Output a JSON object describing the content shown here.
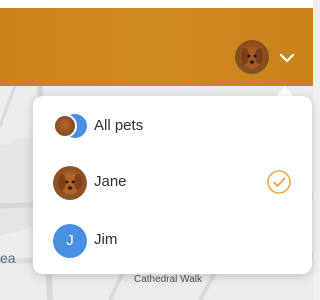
{
  "header": {
    "avatar_icon": "dog-photo-avatar",
    "chevron_icon": "chevron-down-icon",
    "accent_color": "#c98318"
  },
  "map": {
    "label_ea": "ea",
    "label_street": "Cathedral Walk",
    "label_road": "e"
  },
  "pet_menu": {
    "items": [
      {
        "label": "All pets",
        "avatar": "combo-avatar",
        "selected": false
      },
      {
        "label": "Jane",
        "avatar": "dog-photo-avatar",
        "selected": true
      },
      {
        "label": "Jim",
        "avatar": "initial-avatar",
        "initial": "J",
        "selected": false
      }
    ],
    "check_color": "#f0a64a",
    "avatar_color": "#4a90e2"
  }
}
